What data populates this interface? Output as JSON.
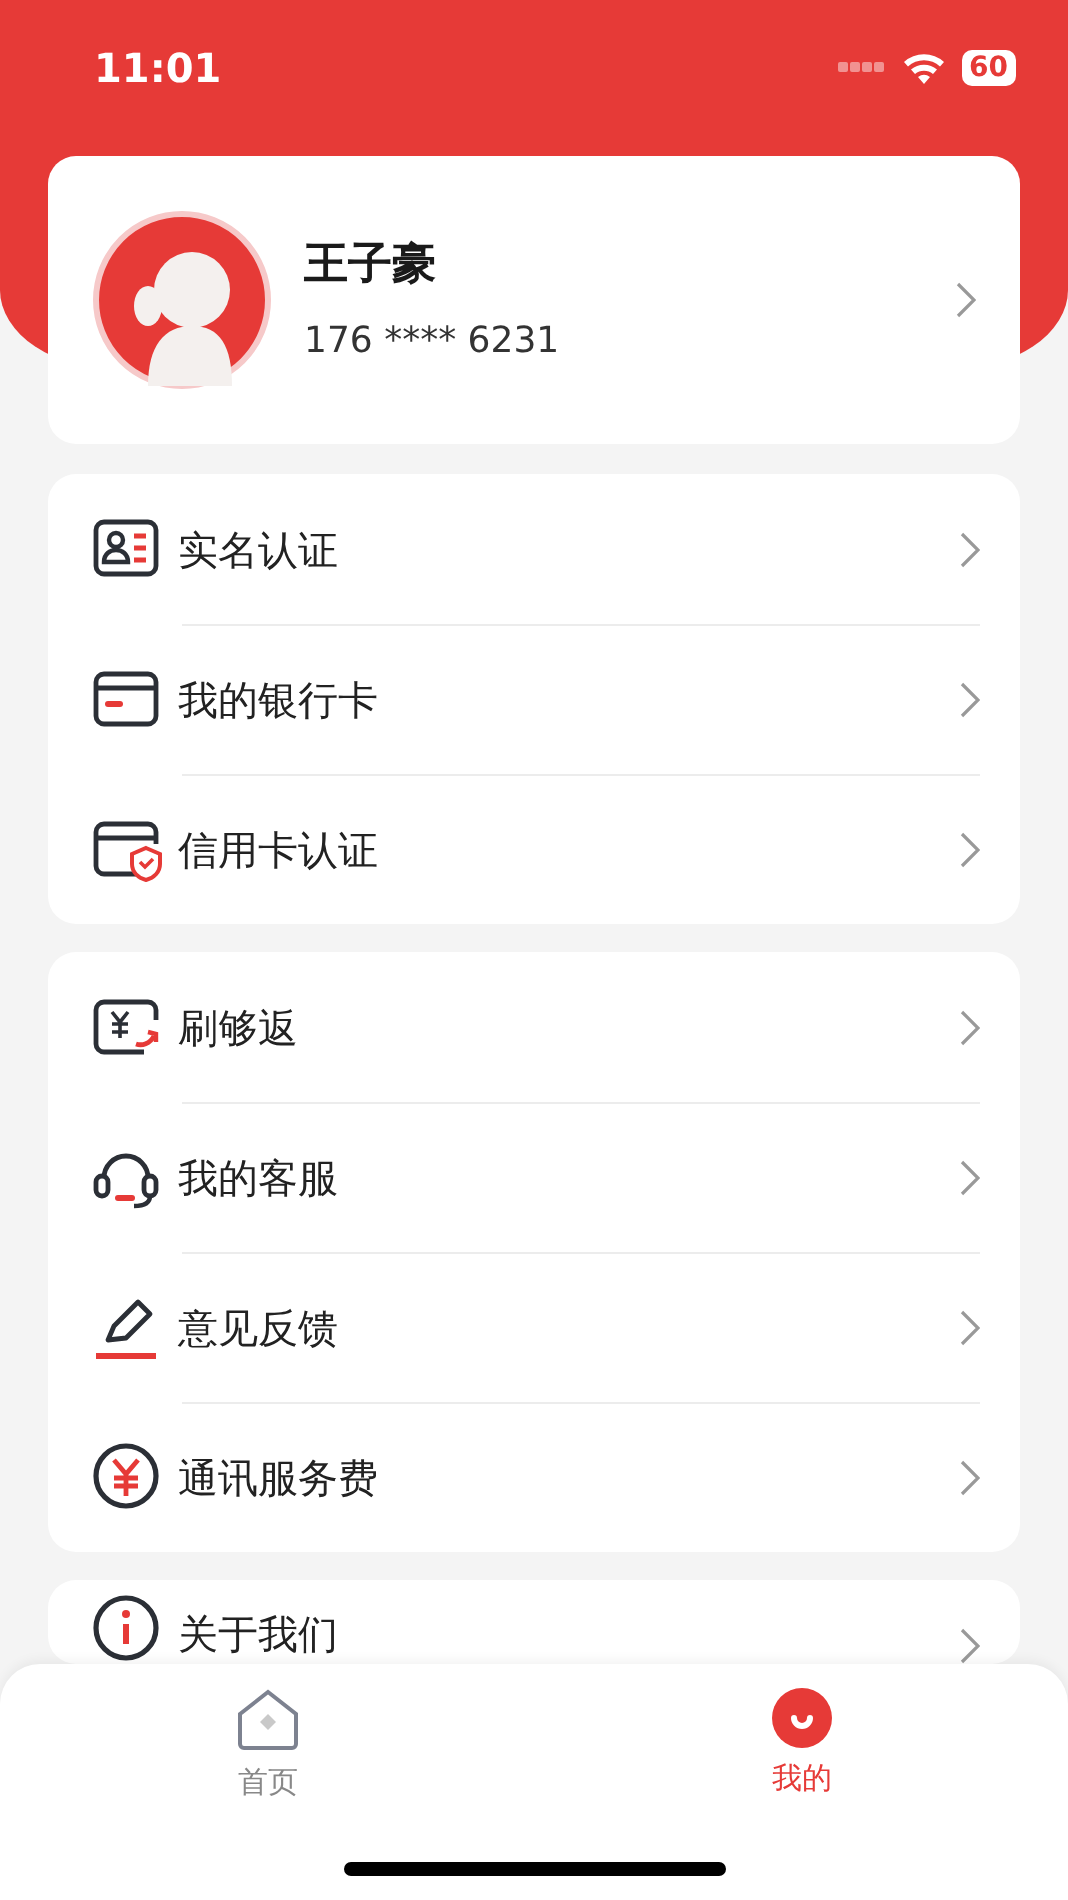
{
  "status_bar": {
    "time": "11:01",
    "battery": "60"
  },
  "profile": {
    "name": "王子豪",
    "phone": "176 **** 6231"
  },
  "menu_groups": [
    {
      "items": [
        {
          "label": "实名认证"
        },
        {
          "label": "我的银行卡"
        },
        {
          "label": "信用卡认证"
        }
      ]
    },
    {
      "items": [
        {
          "label": "刷够返"
        },
        {
          "label": "我的客服"
        },
        {
          "label": "意见反馈"
        },
        {
          "label": "通讯服务费"
        }
      ]
    },
    {
      "items": [
        {
          "label": "关于我们"
        }
      ]
    }
  ],
  "tab_bar": [
    {
      "label": "首页",
      "selected": false
    },
    {
      "label": "我的",
      "selected": true
    }
  ]
}
